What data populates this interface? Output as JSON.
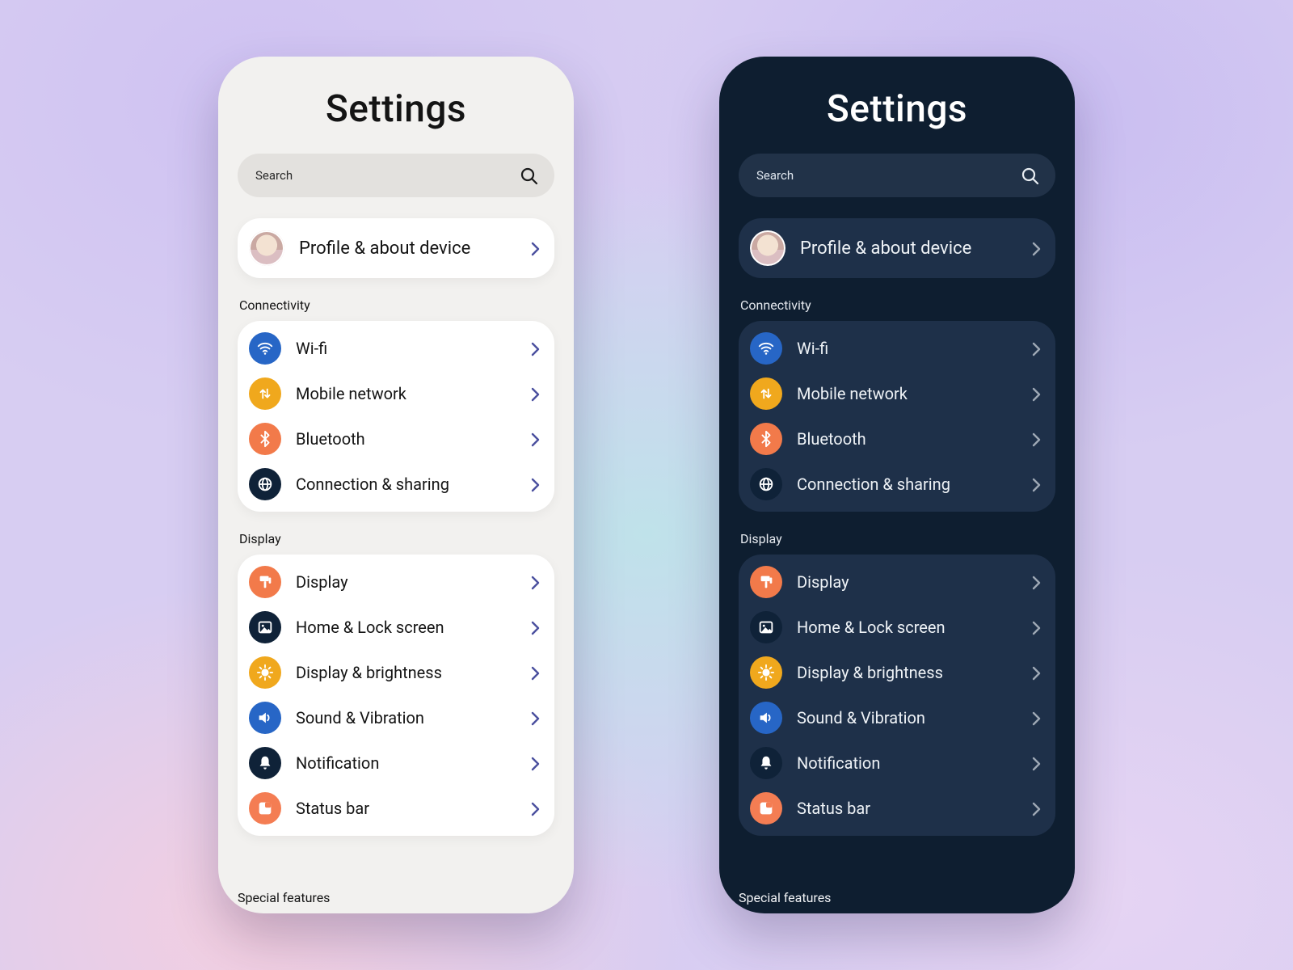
{
  "title": "Settings",
  "search": {
    "placeholder": "Search"
  },
  "profile": {
    "label": "Profile & about device"
  },
  "sections": {
    "connectivity": {
      "header": "Connectivity",
      "items": [
        {
          "label": "Wi-fi",
          "icon": "wifi-icon",
          "color": "c-blue"
        },
        {
          "label": "Mobile network",
          "icon": "data-icon",
          "color": "c-amber"
        },
        {
          "label": "Bluetooth",
          "icon": "bluetooth-icon",
          "color": "c-orange"
        },
        {
          "label": "Connection & sharing",
          "icon": "globe-icon",
          "color": "c-navy"
        }
      ]
    },
    "display": {
      "header": "Display",
      "items": [
        {
          "label": "Display",
          "icon": "paint-icon",
          "color": "c-orange"
        },
        {
          "label": "Home & Lock screen",
          "icon": "image-icon",
          "color": "c-navy"
        },
        {
          "label": "Display & brightness",
          "icon": "sun-icon",
          "color": "c-amber"
        },
        {
          "label": "Sound & Vibration",
          "icon": "speaker-icon",
          "color": "c-blue"
        },
        {
          "label": "Notification",
          "icon": "bell-icon",
          "color": "c-navy"
        },
        {
          "label": "Status bar",
          "icon": "statusbar-icon",
          "color": "c-coral"
        }
      ]
    },
    "special": {
      "header": "Special features"
    }
  },
  "icon_colors": {
    "c-blue": "#2766c6",
    "c-amber": "#f0a81d",
    "c-orange": "#f27a4a",
    "c-navy": "#0f2238",
    "c-coral": "#f47d53"
  }
}
